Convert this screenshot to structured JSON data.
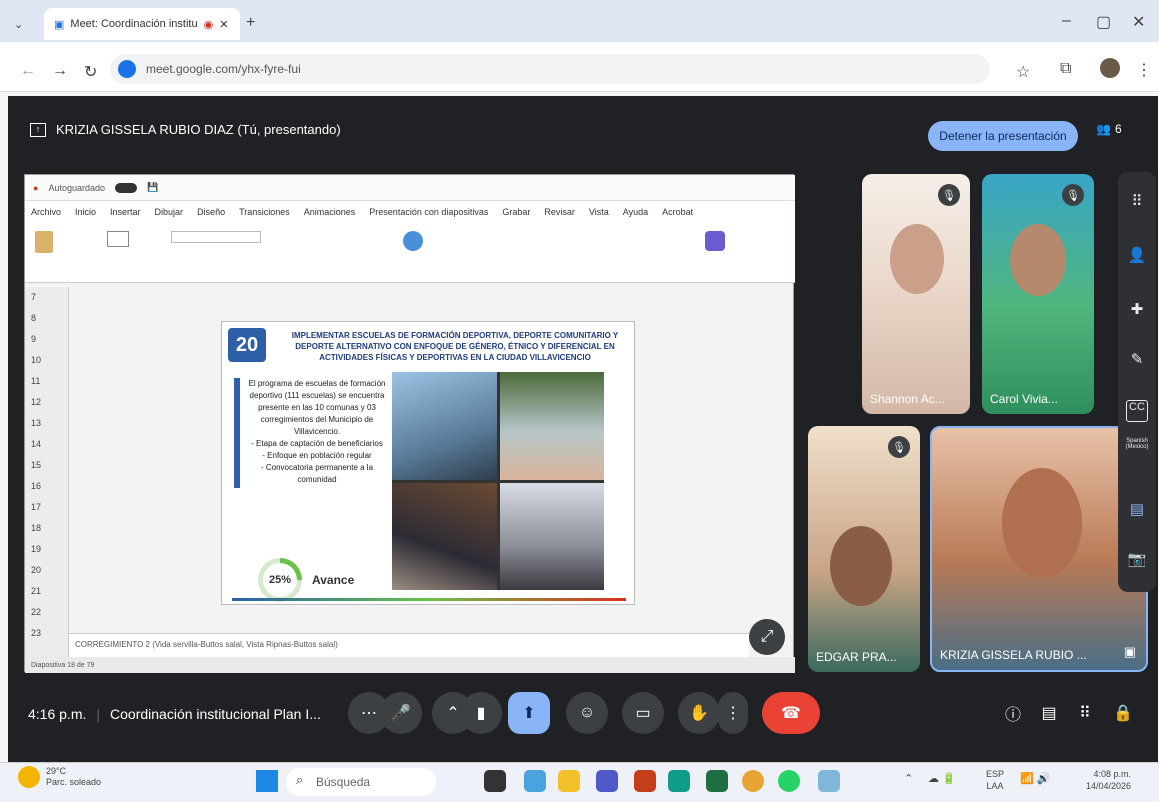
{
  "browser": {
    "tab_title": "Meet: Coordinación institu",
    "url": "meet.google.com/yhx-fyre-fui"
  },
  "meet": {
    "presenter_label": "KRIZIA GISSELA RUBIO DIAZ (Tú, presentando)",
    "stop_label": "Detener la presentación",
    "participant_count": "6",
    "time": "4:16 p.m.",
    "meeting_title": "Coordinación institucional Plan I...",
    "participants": [
      {
        "name": "Shannon Ac..."
      },
      {
        "name": "Carol Vivia..."
      },
      {
        "name": "EDGAR PRA..."
      },
      {
        "name": "KRIZIA GISSELA RUBIO ..."
      }
    ],
    "captions_lang": "Spanish (Mexico)"
  },
  "ppt": {
    "title_bar": "Autoguardado",
    "menu": [
      "Archivo",
      "Inicio",
      "Insertar",
      "Dibujar",
      "Diseño",
      "Transiciones",
      "Animaciones",
      "Presentación con diapositivas",
      "Grabar",
      "Revisar",
      "Vista",
      "Ayuda",
      "Acrobat"
    ],
    "notes": "CORREGIMIENTO 2 (Vida servilla-Buttos salal, Vista Ripnas-Buttos salal)",
    "status": "Diapositiva 18 de 79",
    "slide": {
      "number": "20",
      "title": "IMPLEMENTAR ESCUELAS DE FORMACIÓN DEPORTIVA, DEPORTE COMUNITARIO Y DEPORTE ALTERNATIVO CON ENFOQUE DE GÉNERO, ÉTNICO Y DIFERENCIAL EN ACTIVIDADES FÍSICAS Y DEPORTIVAS EN LA CIUDAD VILLAVICENCIO",
      "body": [
        "El programa de escuelas de formación deportivo (111 escuelas) se encuentra presente en las 10 comunas y 03 corregimientos del Municipio de Villavicencio.",
        "- Etapa de captación de beneficiarios",
        "- Enfoque en población regular",
        "- Convocatoria permanente a la comunidad"
      ],
      "progress_text": "25%",
      "progress_value": 0.25,
      "progress_label": "Avance"
    }
  },
  "taskbar": {
    "weather_temp": "29°C",
    "weather_desc": "Parc. soleado",
    "search": "Búsqueda",
    "lang": "ESP",
    "lang2": "LAA",
    "time": "4:08 p.m.",
    "date": "14/04/2026"
  }
}
